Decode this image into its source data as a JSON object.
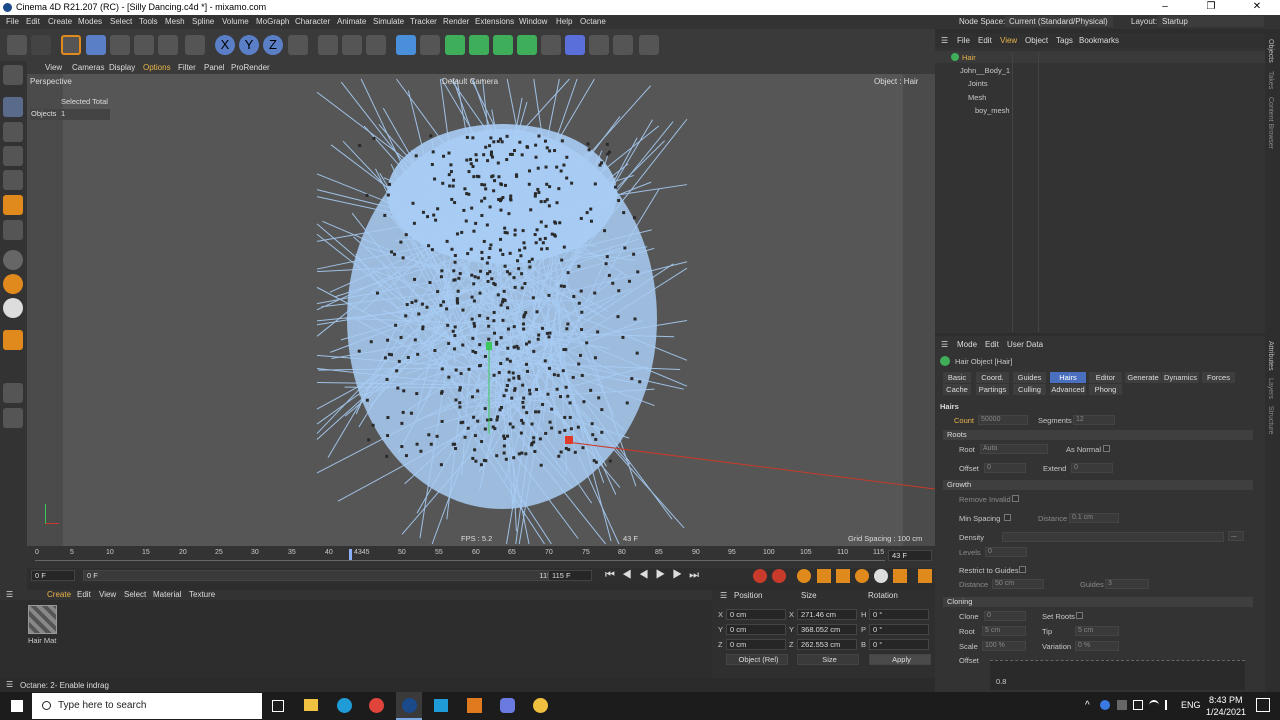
{
  "window": {
    "title": "Cinema 4D R21.207 (RC) - [Silly Dancing.c4d *] - mixamo.com",
    "min": "–",
    "max": "❐",
    "close": "✕"
  },
  "menu": [
    "File",
    "Edit",
    "Create",
    "Modes",
    "Select",
    "Tools",
    "Mesh",
    "Spline",
    "Volume",
    "MoGraph",
    "Character",
    "Animate",
    "Simulate",
    "Tracker",
    "Render",
    "Extensions",
    "Window",
    "Help",
    "Octane"
  ],
  "node_space": {
    "label": "Node Space:",
    "value": "Current (Standard/Physical)"
  },
  "layout": {
    "label": "Layout:",
    "value": "Startup"
  },
  "viewport": {
    "menu": [
      "View",
      "Cameras",
      "Display",
      "Options",
      "Filter",
      "Panel",
      "ProRender"
    ],
    "label": "Perspective",
    "camera": "Default Camera",
    "object_label": "Object : Hair",
    "selected_total": "Selected Total",
    "objects_label": "Objects",
    "objects_count": "1",
    "fps": "FPS : 5.2",
    "frame": "43 F",
    "grid": "Grid Spacing : 100 cm"
  },
  "timeline": {
    "ticks": [
      "0",
      "5",
      "10",
      "15",
      "20",
      "25",
      "30",
      "35",
      "40",
      "4345",
      "50",
      "55",
      "60",
      "65",
      "70",
      "75",
      "80",
      "85",
      "90",
      "95",
      "100",
      "105",
      "110",
      "115"
    ],
    "current": "43 F",
    "start": "0 F",
    "start2": "0 F",
    "end": "115 F",
    "end2": "115 F"
  },
  "materials": {
    "menu": [
      "Create",
      "Edit",
      "View",
      "Select",
      "Material",
      "Texture"
    ],
    "item": "Hair Mat"
  },
  "coords": {
    "headers": [
      "Position",
      "Size",
      "Rotation"
    ],
    "rows": [
      {
        "axis": "X",
        "pos": "0 cm",
        "saxis": "X",
        "size": "271.46 cm",
        "raxis": "H",
        "rot": "0 °"
      },
      {
        "axis": "Y",
        "pos": "0 cm",
        "saxis": "Y",
        "size": "368.052 cm",
        "raxis": "P",
        "rot": "0 °"
      },
      {
        "axis": "Z",
        "pos": "0 cm",
        "saxis": "Z",
        "size": "262.553 cm",
        "raxis": "B",
        "rot": "0 °"
      }
    ],
    "mode": "Object (Rel)",
    "size_mode": "Size",
    "apply": "Apply"
  },
  "status": "Octane:   2- Enable indrag",
  "objects": {
    "menu": [
      "File",
      "Edit",
      "View",
      "Object",
      "Tags",
      "Bookmarks"
    ],
    "items": [
      {
        "name": "Hair",
        "indent": 0
      },
      {
        "name": "John__Body_1",
        "indent": 0
      },
      {
        "name": "Joints",
        "indent": 1
      },
      {
        "name": "Mesh",
        "indent": 1
      },
      {
        "name": "boy_mesh",
        "indent": 2
      }
    ]
  },
  "attributes": {
    "menu": [
      "Mode",
      "Edit",
      "User Data"
    ],
    "title": "Hair Object [Hair]",
    "tabs1": [
      "Basic",
      "Coord.",
      "Guides",
      "Hairs",
      "Editor",
      "Generate",
      "Dynamics",
      "Forces"
    ],
    "tabs2": [
      "Cache",
      "Partings",
      "Culling",
      "Advanced",
      "Phong"
    ],
    "section": "Hairs",
    "count_label": "Count",
    "count": "50000",
    "segments_label": "Segments",
    "segments": "12",
    "roots": "Roots",
    "root_label": "Root",
    "root": "Auto",
    "as_normal": "As Normal",
    "offset_label": "Offset",
    "offset": "0",
    "extend_label": "Extend",
    "extend": "0",
    "growth": "Growth",
    "remove_invalid": "Remove Invalid",
    "min_spacing": "Min Spacing",
    "distance_label": "Distance",
    "distance": "0.1 cm",
    "density_label": "Density",
    "levels_label": "Levels",
    "levels": "0",
    "restrict": "Restrict to Guides",
    "distance2_label": "Distance",
    "distance2": "50 cm",
    "guides_label": "Guides",
    "guides": "3",
    "cloning": "Cloning",
    "clone_label": "Clone",
    "clone": "0",
    "set_roots": "Set Roots",
    "root2_label": "Root",
    "root2": "5 cm",
    "tip_label": "Tip",
    "tip": "5 cm",
    "scale_label": "Scale",
    "scale": "100 %",
    "variation_label": "Variation",
    "variation": "0 %",
    "offset2_label": "Offset",
    "graph_val": "0.8"
  },
  "rightstrip": [
    "Objects",
    "Takes",
    "Content Browser",
    "Attributes",
    "Layers",
    "Structure"
  ],
  "taskbar": {
    "search": "Type here to search",
    "lang": "ENG",
    "time": "8:43 PM",
    "date": "1/24/2021"
  },
  "colors": {
    "accent": "#4a6fbf",
    "hair": "#a8cdf5",
    "viewport_bg": "#4b4b4b"
  }
}
